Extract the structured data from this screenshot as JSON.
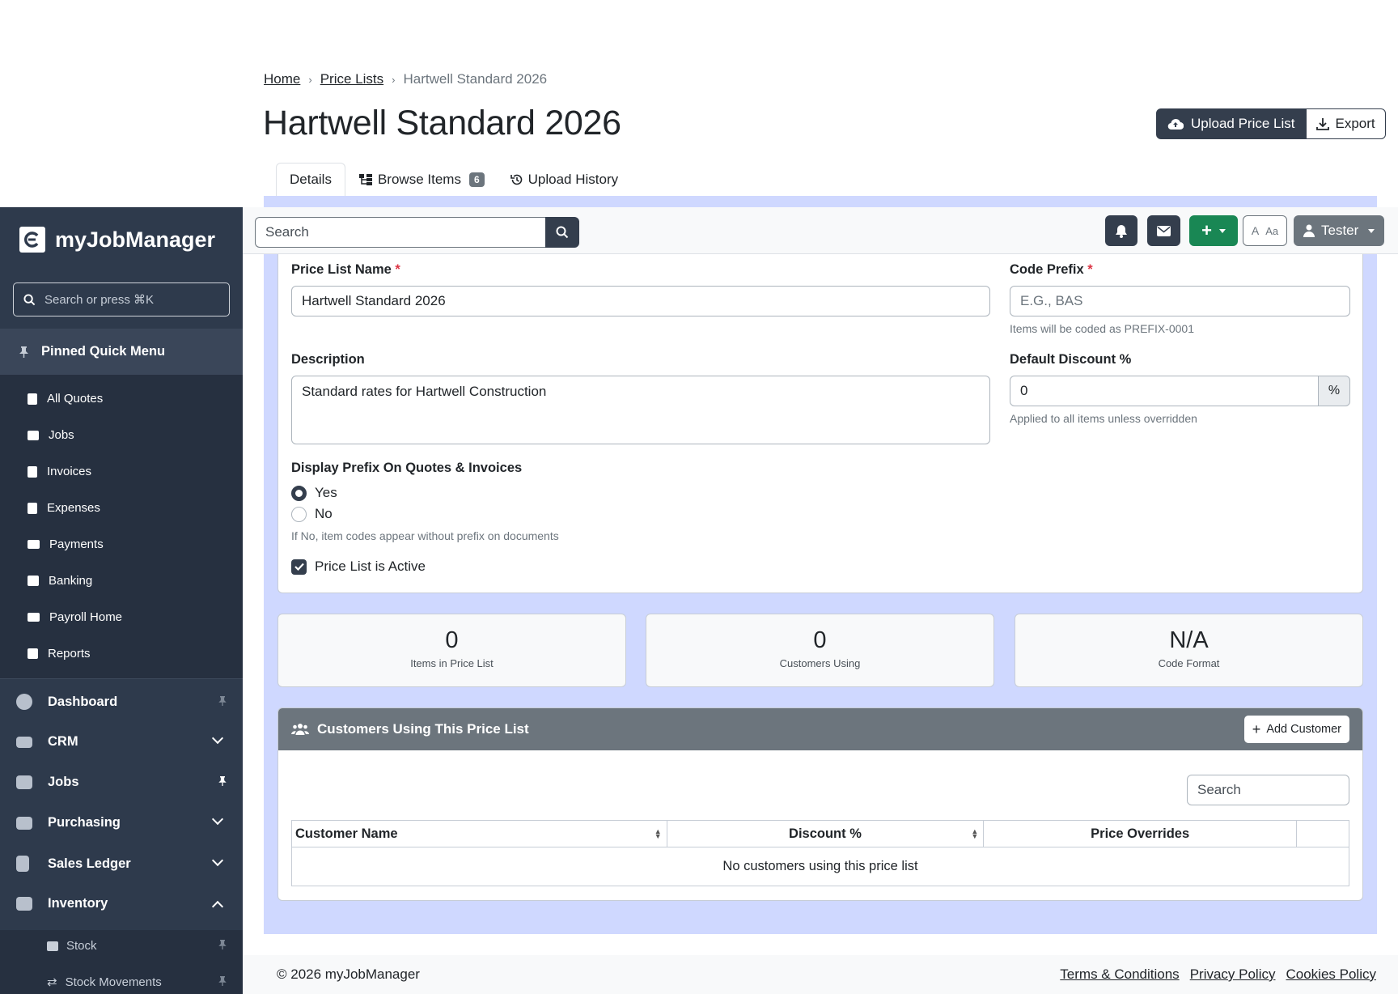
{
  "breadcrumb": {
    "home": "Home",
    "price_lists": "Price Lists",
    "current": "Hartwell Standard 2026"
  },
  "page": {
    "title": "Hartwell Standard 2026",
    "upload_label": "Upload Price List",
    "export_label": "Export"
  },
  "tabs": {
    "details": "Details",
    "browse": "Browse Items",
    "browse_count": "6",
    "history": "Upload History"
  },
  "form": {
    "name_label": "Price List Name",
    "name_value": "Hartwell Standard 2026",
    "code_label": "Code Prefix",
    "code_placeholder": "E.G., BAS",
    "code_help": "Items will be coded as PREFIX-0001",
    "desc_label": "Description",
    "desc_value": "Standard rates for Hartwell Construction",
    "discount_label": "Default Discount %",
    "discount_value": "0",
    "discount_suffix": "%",
    "discount_help": "Applied to all items unless overridden",
    "prefix_label": "Display Prefix On Quotes & Invoices",
    "yes": "Yes",
    "no": "No",
    "prefix_help": "If No, item codes appear without prefix on documents",
    "active_label": "Price List is Active",
    "required": "*"
  },
  "stats": [
    {
      "value": "0",
      "label": "Items in Price List"
    },
    {
      "value": "0",
      "label": "Customers Using"
    },
    {
      "value": "N/A",
      "label": "Code Format"
    }
  ],
  "customers": {
    "title": "Customers Using This Price List",
    "add_label": "Add Customer",
    "search_placeholder": "Search",
    "columns": [
      "Customer Name",
      "Discount %",
      "Price Overrides"
    ],
    "empty": "No customers using this price list"
  },
  "footer": {
    "copyright": "© 2026 myJobManager",
    "terms": "Terms & Conditions",
    "privacy": "Privacy Policy",
    "cookies": "Cookies Policy"
  },
  "topbar": {
    "search_placeholder": "Search",
    "user": "Tester",
    "font_small": "A",
    "font_large": "Aa"
  },
  "sidebar": {
    "brand": "myJobManager",
    "search_placeholder": "Search or press ⌘K",
    "pinned_label": "Pinned Quick Menu",
    "quick": [
      "All Quotes",
      "Jobs",
      "Invoices",
      "Expenses",
      "Payments",
      "Banking",
      "Payroll Home",
      "Reports"
    ],
    "nav": [
      "Dashboard",
      "CRM",
      "Jobs",
      "Purchasing",
      "Sales Ledger",
      "Inventory"
    ],
    "sub": [
      "Stock",
      "Stock Movements"
    ]
  },
  "colors": {
    "dark": "#343e4d",
    "sidebar": "#2e3a4c",
    "accent_bg": "#cfd8ff",
    "success": "#198754",
    "required": "#dc3545"
  }
}
